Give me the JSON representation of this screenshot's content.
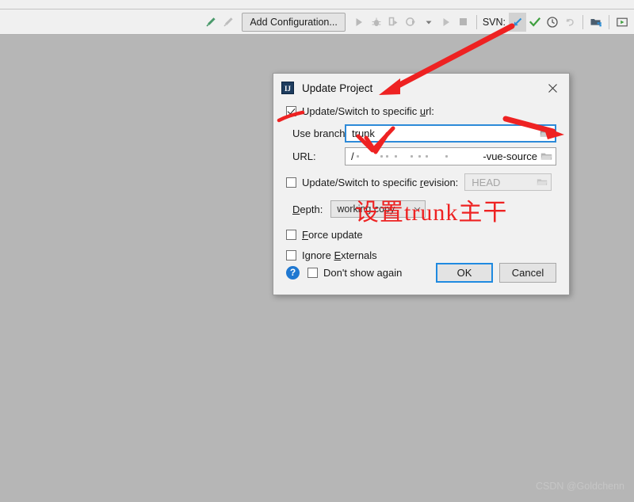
{
  "toolbar": {
    "add_configuration_label": "Add Configuration...",
    "svn_label": "SVN:",
    "icons": [
      {
        "name": "build-hammer-icon",
        "glyph": "hammer"
      },
      {
        "name": "build-hammer-disabled-icon",
        "glyph": "hammer"
      },
      {
        "name": "run-icon",
        "glyph": "play"
      },
      {
        "name": "debug-icon",
        "glyph": "bug"
      },
      {
        "name": "run-with-coverage-icon",
        "glyph": "run-coverage"
      },
      {
        "name": "profile-icon",
        "glyph": "profile"
      },
      {
        "name": "dropdown-chevron-icon",
        "glyph": "chevron-down"
      },
      {
        "name": "attach-run-icon",
        "glyph": "play"
      },
      {
        "name": "stop-icon",
        "glyph": "square"
      },
      {
        "name": "svn-update-icon",
        "glyph": "arrow-down-left"
      },
      {
        "name": "svn-commit-icon",
        "glyph": "check"
      },
      {
        "name": "svn-history-icon",
        "glyph": "clock"
      },
      {
        "name": "svn-rollback-icon",
        "glyph": "undo"
      },
      {
        "name": "project-structure-icon",
        "glyph": "folders"
      },
      {
        "name": "preview-icon",
        "glyph": "window-play"
      }
    ]
  },
  "dialog": {
    "title": "Update Project",
    "app_icon_text": "IJ",
    "close_label": "×",
    "update_switch_url": {
      "label_prefix": "Update/Switch to specific ",
      "label_underlined": "u",
      "label_suffix": "rl:",
      "checked": true
    },
    "use_branch": {
      "label": "Use branch:",
      "value": "trunk",
      "browse_title": "Browse"
    },
    "url": {
      "label": "URL:",
      "value_prefix": "/",
      "value_tail": "-vue-source",
      "browse_title": "Browse"
    },
    "update_switch_revision": {
      "label_prefix": "Update/Switch to specific ",
      "label_underlined": "r",
      "label_suffix": "evision:",
      "checked": false,
      "value": "HEAD"
    },
    "depth": {
      "label_underlined": "D",
      "label_suffix": "epth:",
      "value": "working copy"
    },
    "force_update": {
      "label_underlined": "F",
      "label_suffix": "orce update",
      "checked": false
    },
    "ignore_externals": {
      "label_prefix": "Ignore ",
      "label_underlined": "E",
      "label_suffix": "xternals",
      "checked": false
    },
    "help_label": "?",
    "dont_show_again": {
      "label": "Don't show again",
      "checked": false
    },
    "ok_label": "OK",
    "cancel_label": "Cancel"
  },
  "annotations": {
    "set_trunk_text": "设置trunk主干",
    "color": "#ee2222"
  },
  "watermark": "CSDN @Goldchenn",
  "colors": {
    "background": "#b6b6b6",
    "toolbar": "#f0f0f0",
    "dialog": "#f1f1f1",
    "accent_blue": "#2d8ad8",
    "annotation_red": "#ee2222",
    "svn_commit_green": "#3f9f3f"
  }
}
